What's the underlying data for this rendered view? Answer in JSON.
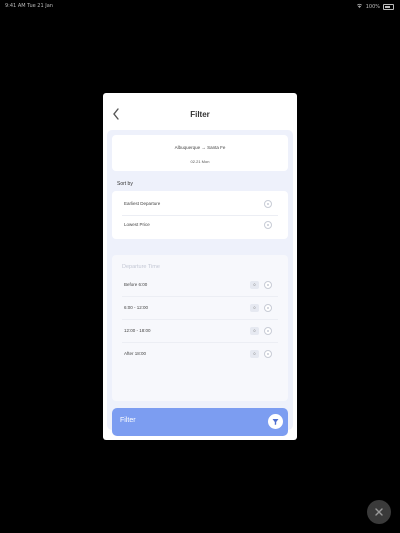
{
  "status_bar": {
    "time": "9:41 AM",
    "date": "Tue 21 Jan",
    "battery": "100%"
  },
  "modal": {
    "title": "Filter"
  },
  "route": {
    "line": "Albuquerque → Santa Fe",
    "date": "02.21 Mon"
  },
  "sort": {
    "label": "Sort by",
    "options": [
      {
        "label": "Earliest Departure"
      },
      {
        "label": "Lowest Price"
      }
    ]
  },
  "departure": {
    "title": "Departure Time",
    "options": [
      {
        "label": "Before 6:00",
        "count": "0"
      },
      {
        "label": "6:00 - 12:00",
        "count": "0"
      },
      {
        "label": "12:00 - 18:00",
        "count": "0"
      },
      {
        "label": "After 18:00",
        "count": "0"
      }
    ]
  },
  "filter_button": {
    "label": "Filter"
  },
  "colors": {
    "accent": "#7c9df1",
    "panel_bg": "#eef1fb",
    "backdrop": "#000000"
  },
  "icons": {
    "back": "chevron-left-icon",
    "filter": "filter-icon",
    "radio": "radio-icon",
    "floating": "collapse-icon"
  }
}
